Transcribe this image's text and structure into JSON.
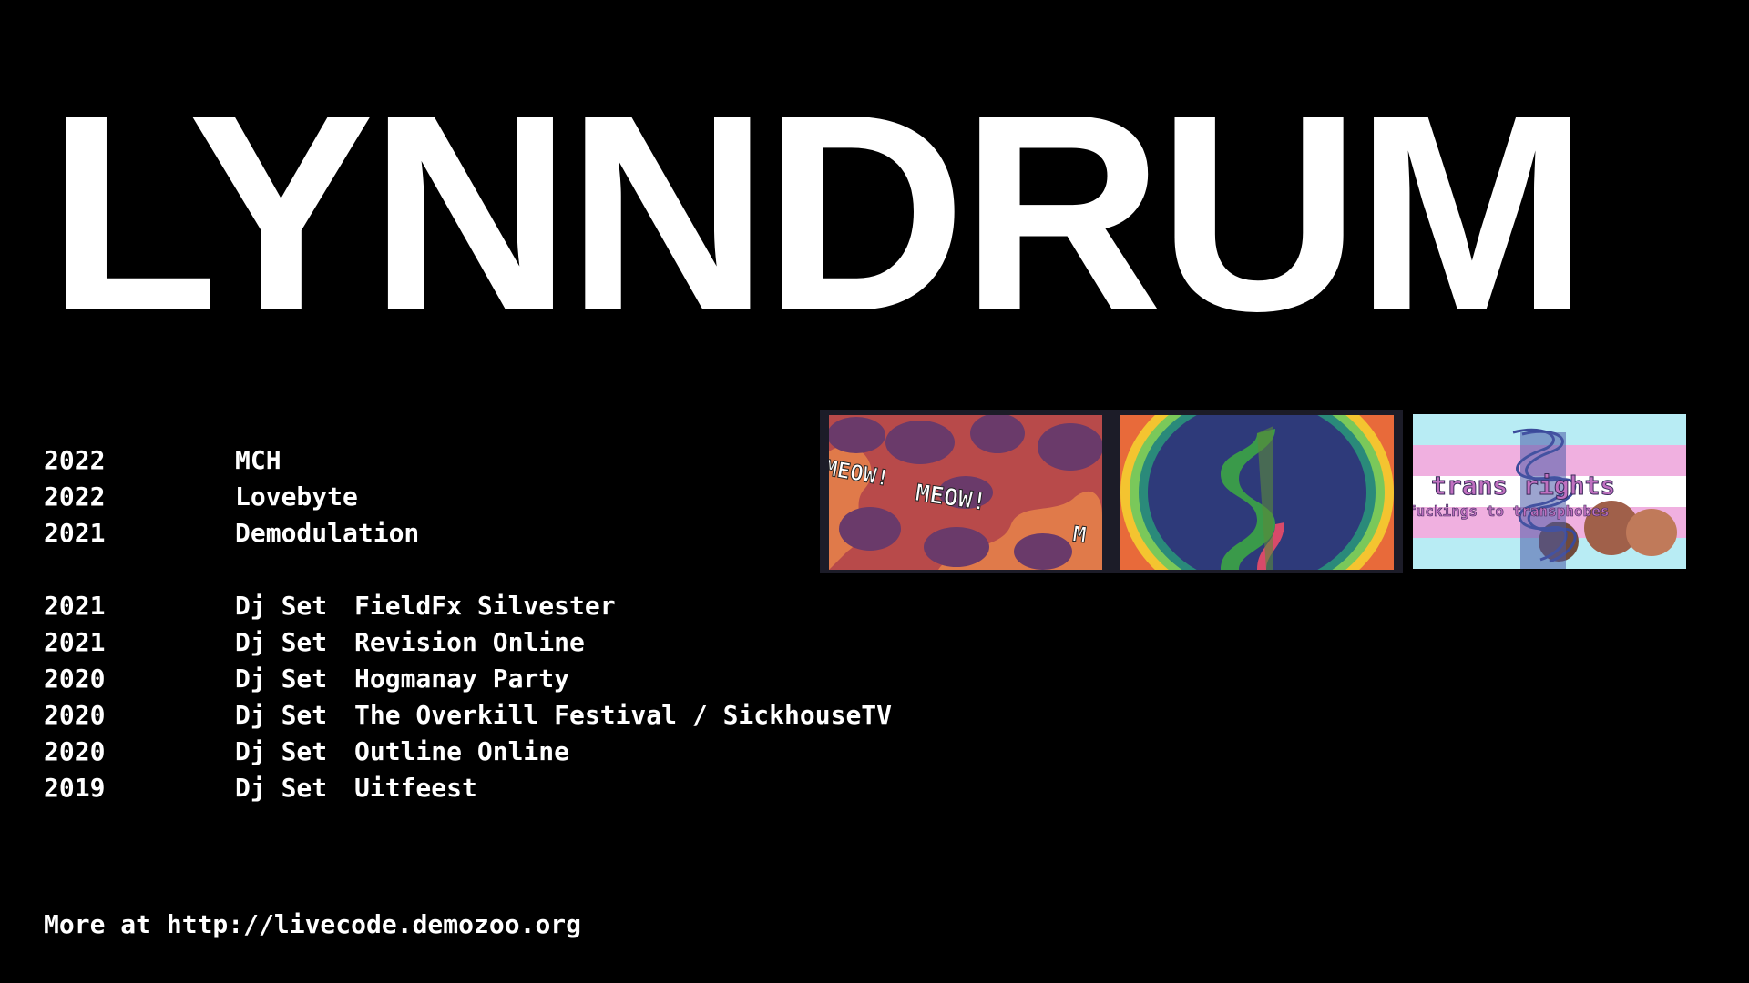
{
  "title": "LYNNDRUM",
  "events": [
    {
      "year": "2022",
      "kind": "MCH",
      "name": ""
    },
    {
      "year": "2022",
      "kind": "Lovebyte",
      "name": ""
    },
    {
      "year": "2021",
      "kind": "Demodulation",
      "name": ""
    },
    {
      "year": "2021",
      "kind": "Dj Set",
      "name": "FieldFx Silvester"
    },
    {
      "year": "2021",
      "kind": "Dj Set",
      "name": "Revision Online"
    },
    {
      "year": "2020",
      "kind": "Dj Set",
      "name": "Hogmanay Party"
    },
    {
      "year": "2020",
      "kind": "Dj Set",
      "name": "The Overkill Festival / SickhouseTV"
    },
    {
      "year": "2020",
      "kind": "Dj Set",
      "name": "Outline Online"
    },
    {
      "year": "2019",
      "kind": "Dj Set",
      "name": "Uitfeest"
    }
  ],
  "footer": "More at http://livecode.demozoo.org",
  "thumbnails": {
    "meow": {
      "text_1": "MEOW!",
      "text_2": "MEOW!",
      "text_3": "M"
    },
    "spiral": {},
    "trans": {
      "line_1": "trans rights",
      "line_2": "fuckings to transphobes"
    }
  },
  "colors": {
    "background": "#000000",
    "text": "#ffffff",
    "thumb_frame": "#1c1c28"
  }
}
